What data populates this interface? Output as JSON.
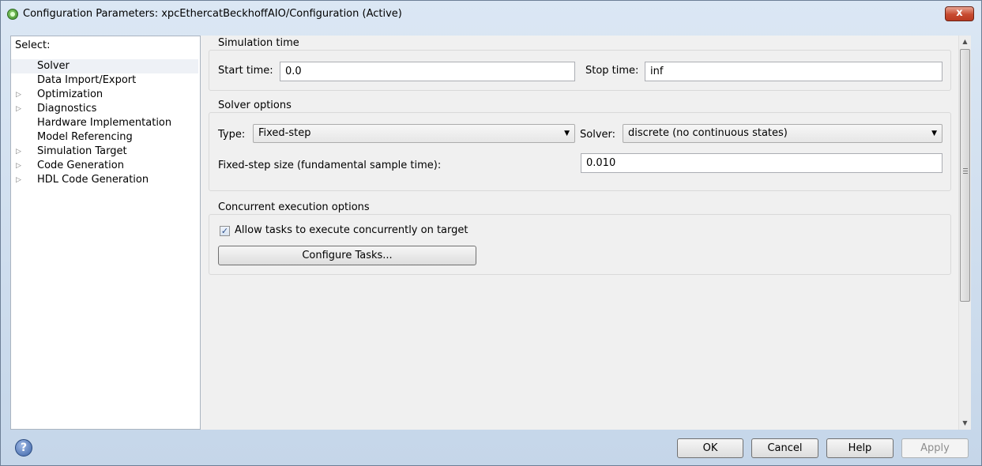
{
  "window": {
    "title": "Configuration Parameters: xpcEthercatBeckhoffAIO/Configuration (Active)",
    "close_label": "x"
  },
  "tree": {
    "header": "Select:",
    "items": [
      {
        "label": "Solver",
        "expandable": false,
        "selected": true
      },
      {
        "label": "Data Import/Export",
        "expandable": false,
        "selected": false
      },
      {
        "label": "Optimization",
        "expandable": true,
        "selected": false
      },
      {
        "label": "Diagnostics",
        "expandable": true,
        "selected": false
      },
      {
        "label": "Hardware Implementation",
        "expandable": false,
        "selected": false
      },
      {
        "label": "Model Referencing",
        "expandable": false,
        "selected": false
      },
      {
        "label": "Simulation Target",
        "expandable": true,
        "selected": false
      },
      {
        "label": "Code Generation",
        "expandable": true,
        "selected": false
      },
      {
        "label": "HDL Code Generation",
        "expandable": true,
        "selected": false
      }
    ],
    "expand_glyph": "▷"
  },
  "simulation_time": {
    "title": "Simulation time",
    "start_label": "Start time:",
    "start_value": "0.0",
    "stop_label": "Stop time:",
    "stop_value": "inf"
  },
  "solver_options": {
    "title": "Solver options",
    "type_label": "Type:",
    "type_value": "Fixed-step",
    "solver_label": "Solver:",
    "solver_value": "discrete (no continuous states)",
    "step_label": "Fixed-step size (fundamental sample time):",
    "step_value": "0.010",
    "dropdown_glyph": "▼"
  },
  "concurrent": {
    "title": "Concurrent execution options",
    "checkbox_label": "Allow tasks to execute concurrently on target",
    "checkbox_checked": true,
    "check_glyph": "✓",
    "configure_button": "Configure Tasks..."
  },
  "buttons": {
    "ok": "OK",
    "cancel": "Cancel",
    "help": "Help",
    "apply": "Apply",
    "help_icon": "?"
  },
  "scroll": {
    "up": "▲",
    "down": "▼"
  },
  "colors": {
    "title_bg": "#c9d9ea",
    "close_button": "#c74a30",
    "panel_bg": "#f0f0f0",
    "tree_selection": "#eef1f6"
  }
}
